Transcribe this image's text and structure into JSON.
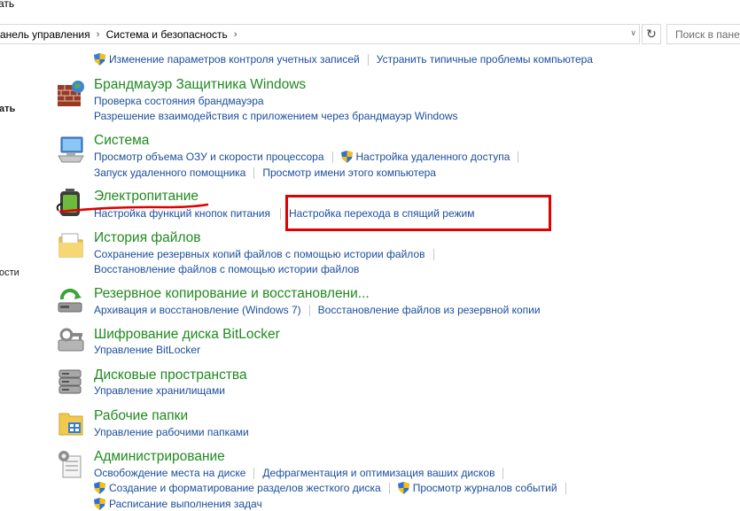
{
  "window": {
    "title_fragment": "ать"
  },
  "address": {
    "crumb1": "анель управления",
    "crumb2": "Система и безопасность",
    "search_placeholder": "Поиск в пане"
  },
  "left_nav": {
    "item1": "ать",
    "item2": "ости"
  },
  "top_links": {
    "uac": "Изменение параметров контроля учетных записей",
    "troubleshoot": "Устранить типичные проблемы компьютера"
  },
  "categories": {
    "firewall": {
      "title": "Брандмауэр Защитника Windows",
      "link1": "Проверка состояния брандмауэра",
      "link2": "Разрешение взаимодействия с приложением через брандмауэр Windows"
    },
    "system": {
      "title": "Система",
      "link1": "Просмотр объема ОЗУ и скорости процессора",
      "link2": "Настройка удаленного доступа",
      "link3": "Запуск удаленного помощника",
      "link4": "Просмотр имени этого компьютера"
    },
    "power": {
      "title": "Электропитание",
      "link1": "Настройка функций кнопок питания",
      "link2": "Настройка перехода в спящий режим"
    },
    "filehistory": {
      "title": "История файлов",
      "link1": "Сохранение резервных копий файлов с помощью истории файлов",
      "link2": "Восстановление файлов с помощью истории файлов"
    },
    "backup": {
      "title": "Резервное копирование и восстановлени...",
      "link1": "Архивация и восстановление (Windows 7)",
      "link2": "Восстановление файлов из резервной копии"
    },
    "bitlocker": {
      "title": "Шифрование диска BitLocker",
      "link1": "Управление BitLocker"
    },
    "storage": {
      "title": "Дисковые пространства",
      "link1": "Управление хранилищами"
    },
    "workfolders": {
      "title": "Рабочие папки",
      "link1": "Управление рабочими папками"
    },
    "admin": {
      "title": "Администрирование",
      "link1": "Освобождение места на диске",
      "link2": "Дефрагментация и оптимизация ваших дисков",
      "link3": "Создание и форматирование разделов жесткого диска",
      "link4": "Просмотр журналов событий",
      "link5": "Расписание выполнения задач"
    }
  },
  "colors": {
    "link": "#1b4d9c",
    "category_title": "#1f8a1f",
    "annotation": "#e00000"
  }
}
